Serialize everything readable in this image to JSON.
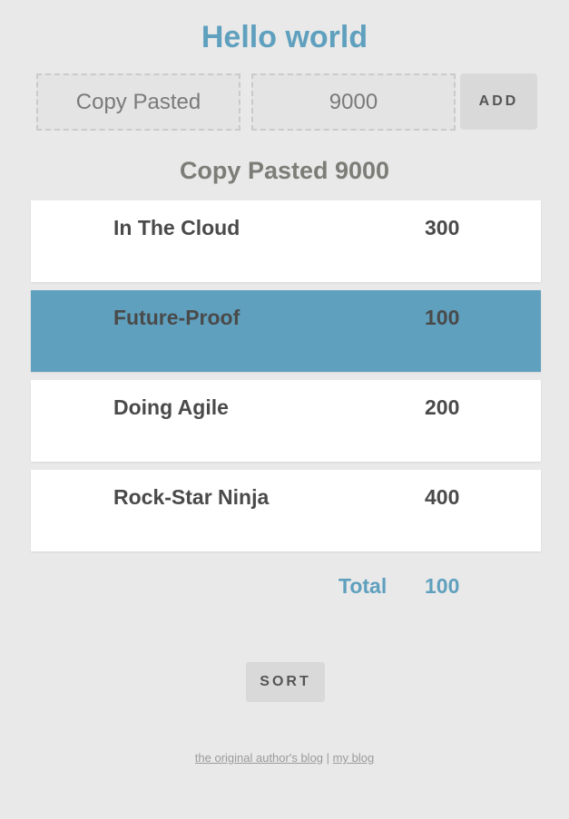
{
  "title": "Hello world",
  "form": {
    "name_value": "Copy Pasted",
    "amount_value": "9000",
    "add_label": "ADD"
  },
  "preview": "Copy Pasted 9000",
  "items": [
    {
      "name": "In The Cloud",
      "value": "300",
      "selected": false
    },
    {
      "name": "Future-Proof",
      "value": "100",
      "selected": true
    },
    {
      "name": "Doing Agile",
      "value": "200",
      "selected": false
    },
    {
      "name": "Rock-Star Ninja",
      "value": "400",
      "selected": false
    }
  ],
  "total": {
    "label": "Total",
    "value": "100"
  },
  "sort_label": "SORT",
  "footer": {
    "link1": "the original author's blog",
    "separator": "|",
    "link2": "my blog"
  },
  "colors": {
    "accent": "#5fa0be",
    "background": "#e9e9e9",
    "text": "#4a4a4a"
  }
}
